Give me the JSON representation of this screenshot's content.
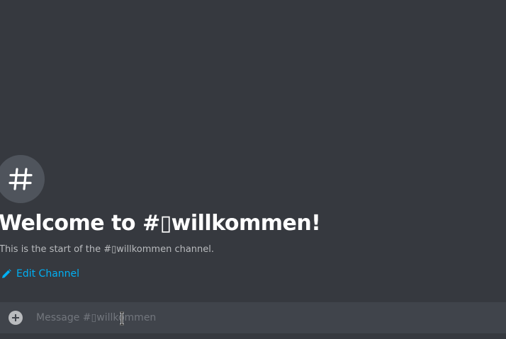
{
  "channel": {
    "icon": "hash-icon",
    "welcome_title": "Welcome to #▯willkommen!",
    "welcome_subtitle": "This is the start of the #▯willkommen channel.",
    "edit_label": "Edit Channel",
    "edit_icon": "pencil-icon"
  },
  "composer": {
    "attach_icon": "plus-circle-icon",
    "placeholder": "Message #▯willkommen"
  },
  "colors": {
    "background": "#36393f",
    "composer": "#40444b",
    "link": "#00b0f4",
    "muted_text": "#b9bbbe",
    "placeholder": "#72767d"
  }
}
